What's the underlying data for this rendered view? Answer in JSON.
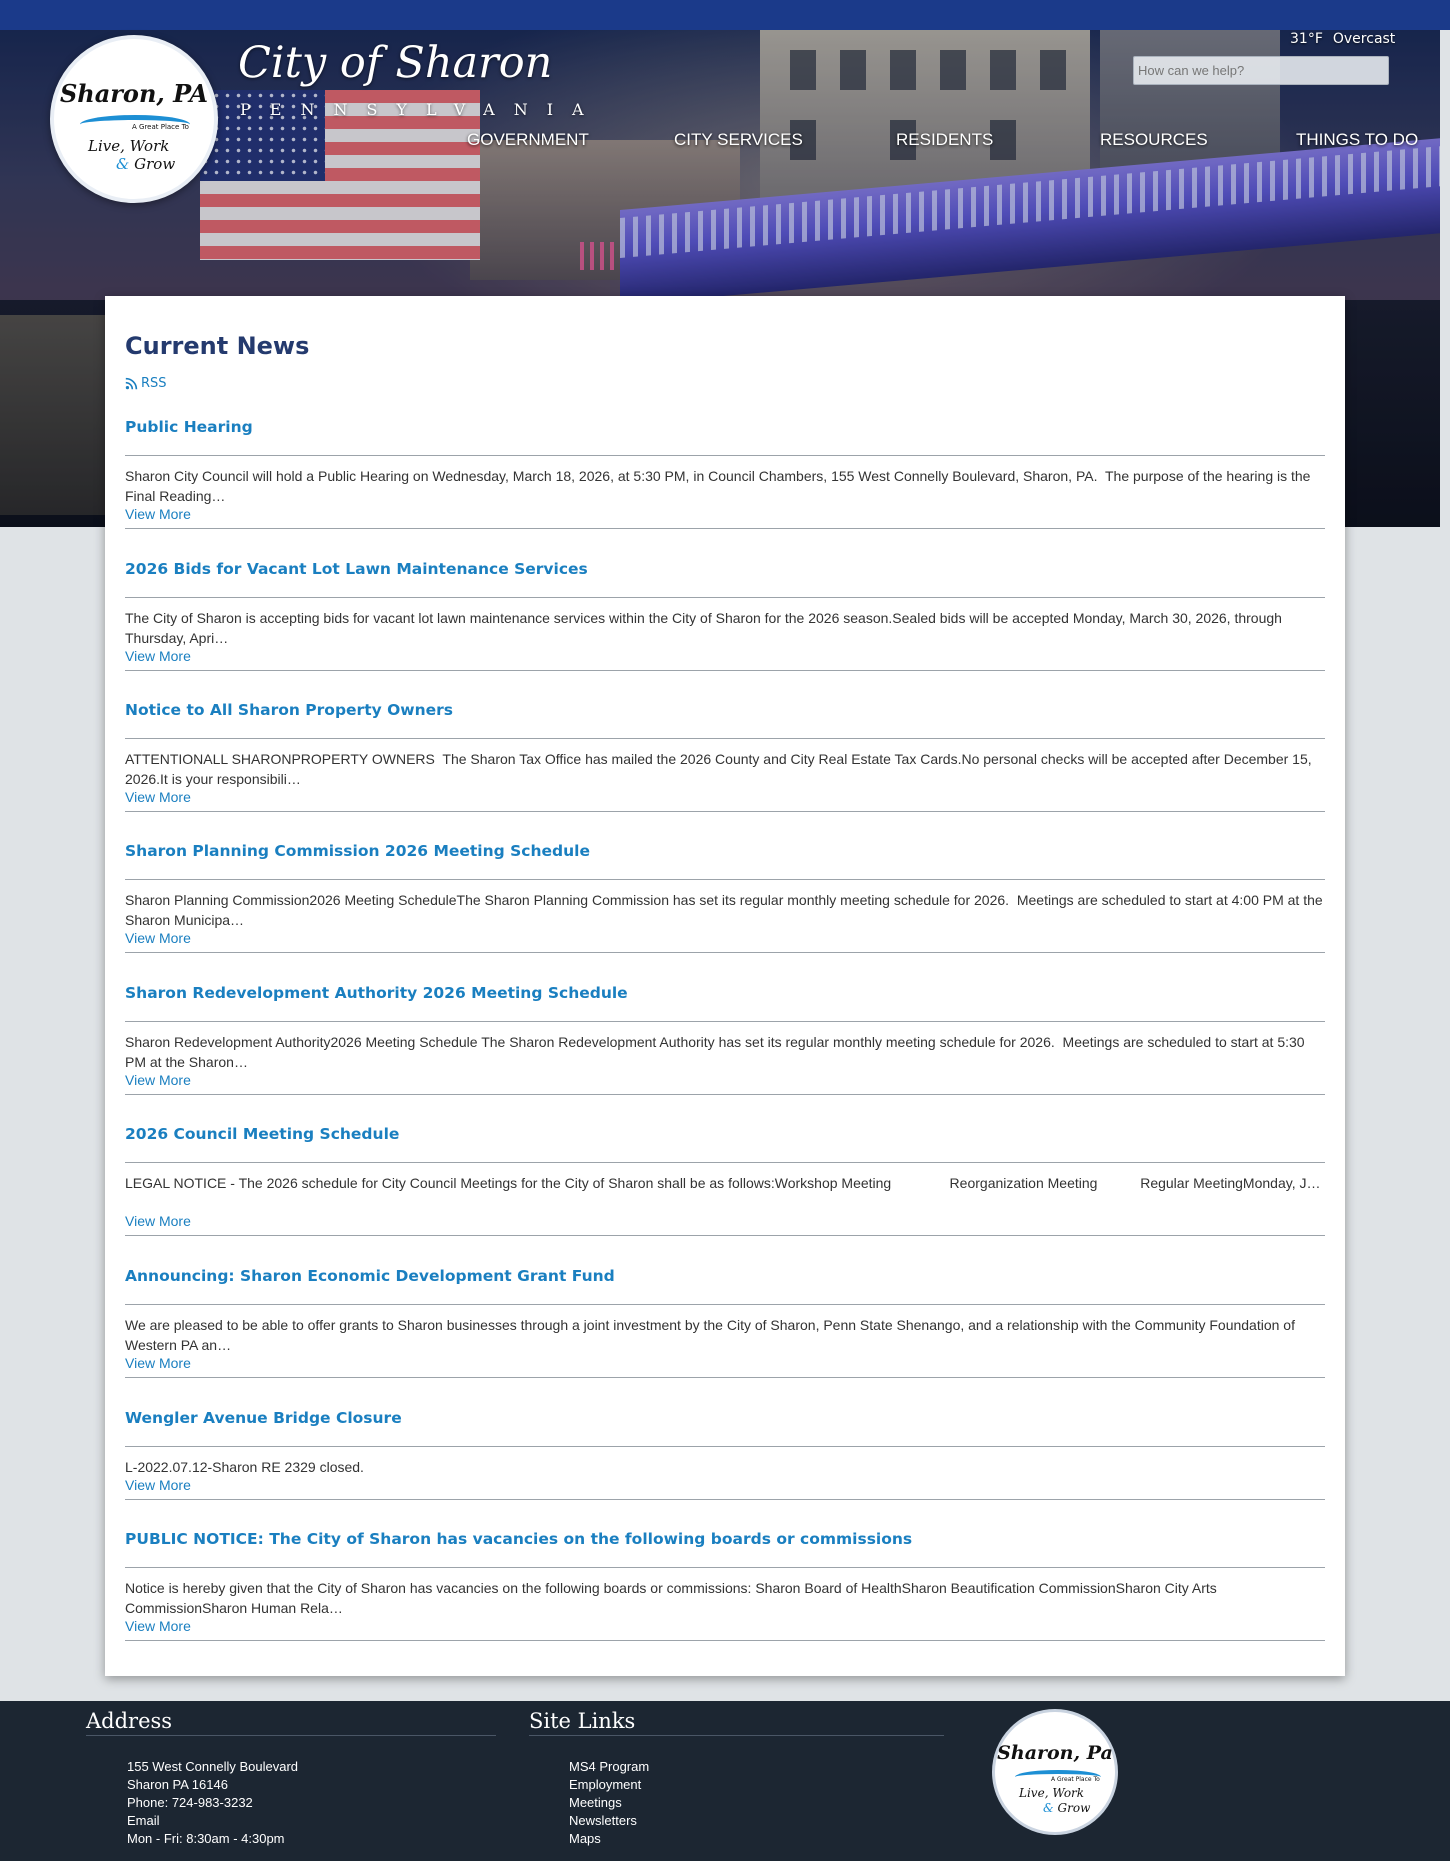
{
  "header": {
    "weather": {
      "temp": "31°F",
      "condition": "Overcast"
    },
    "search_placeholder": "How can we help?",
    "brand_title": "City of Sharon",
    "brand_subtitle": "PENNSYLVANIA",
    "logo": {
      "name": "Sharon, PA",
      "tagline": "A Great Place To",
      "line1": "Live, Work",
      "amp": "&",
      "line2": "Grow"
    },
    "nav": [
      "GOVERNMENT",
      "CITY SERVICES",
      "RESIDENTS",
      "RESOURCES",
      "THINGS TO DO"
    ]
  },
  "news": {
    "heading": "Current News",
    "rss_label": "RSS",
    "view_more_label": "View More",
    "items": [
      {
        "title": "Public Hearing",
        "summary": "Sharon City Council will hold a Public Hearing on Wednesday, March 18, 2026, at 5:30 PM, in Council Chambers, 155 West Connelly Boulevard, Sharon, PA.  The purpose of the hearing is the Final Reading…"
      },
      {
        "title": "2026 Bids for Vacant Lot Lawn Maintenance Services",
        "summary": "The City of Sharon is accepting bids for vacant lot lawn maintenance services within the City of Sharon for the 2026 season.Sealed bids will be accepted Monday, March 30, 2026, through Thursday, Apri…"
      },
      {
        "title": "Notice to All Sharon Property Owners",
        "summary": "ATTENTIONALL SHARONPROPERTY OWNERS  The Sharon Tax Office has mailed the 2026 County and City Real Estate Tax Cards.No personal checks will be accepted after December 15, 2026.It is your responsibili…"
      },
      {
        "title": "Sharon Planning Commission 2026 Meeting Schedule",
        "summary": "Sharon Planning Commission2026 Meeting ScheduleThe Sharon Planning Commission has set its regular monthly meeting schedule for 2026.  Meetings are scheduled to start at 4:00 PM at the Sharon Municipa…"
      },
      {
        "title": "Sharon Redevelopment Authority 2026 Meeting Schedule",
        "summary": "Sharon Redevelopment Authority2026 Meeting Schedule The Sharon Redevelopment Authority has set its regular monthly meeting schedule for 2026.  Meetings are scheduled to start at 5:30 PM at the Sharon…"
      },
      {
        "title": "2026 Council Meeting Schedule",
        "summary": "LEGAL NOTICE - The 2026 schedule for City Council Meetings for the City of Sharon shall be as follows:Workshop Meeting               Reorganization Meeting           Regular MeetingMonday, J…"
      },
      {
        "title": "Announcing: Sharon Economic Development Grant Fund",
        "summary": "We are pleased to be able to offer grants to Sharon businesses through a joint investment by the City of Sharon, Penn State Shenango, and a relationship with the Community Foundation of Western PA an…"
      },
      {
        "title": "Wengler Avenue Bridge Closure",
        "summary": "L-2022.07.12-Sharon RE 2329 closed."
      },
      {
        "title": "PUBLIC NOTICE: The City of Sharon has vacancies on the following boards or commissions",
        "summary": "Notice is hereby given that the City of Sharon has vacancies on the following boards or commissions: Sharon Board of HealthSharon Beautification CommissionSharon City Arts CommissionSharon Human Rela…"
      }
    ]
  },
  "footer": {
    "address_heading": "Address",
    "address_lines": [
      "155 West Connelly Boulevard",
      "Sharon PA 16146",
      "Phone: 724-983-3232",
      "Email",
      "Mon - Fri: 8:30am - 4:30pm"
    ],
    "links_heading": "Site Links",
    "links": [
      "MS4 Program",
      "Employment",
      "Meetings",
      "Newsletters",
      "Maps"
    ],
    "logo": {
      "name": "Sharon, Pa",
      "tagline": "A Great Place To",
      "line1": "Live, Work",
      "amp": "&",
      "line2": "Grow"
    }
  },
  "colors": {
    "topbar": "#1b3a8a",
    "heading": "#243a6e",
    "link": "#1a7fc0",
    "footer_bg": "#1c2632"
  },
  "icons": {
    "rss": "rss-icon"
  }
}
